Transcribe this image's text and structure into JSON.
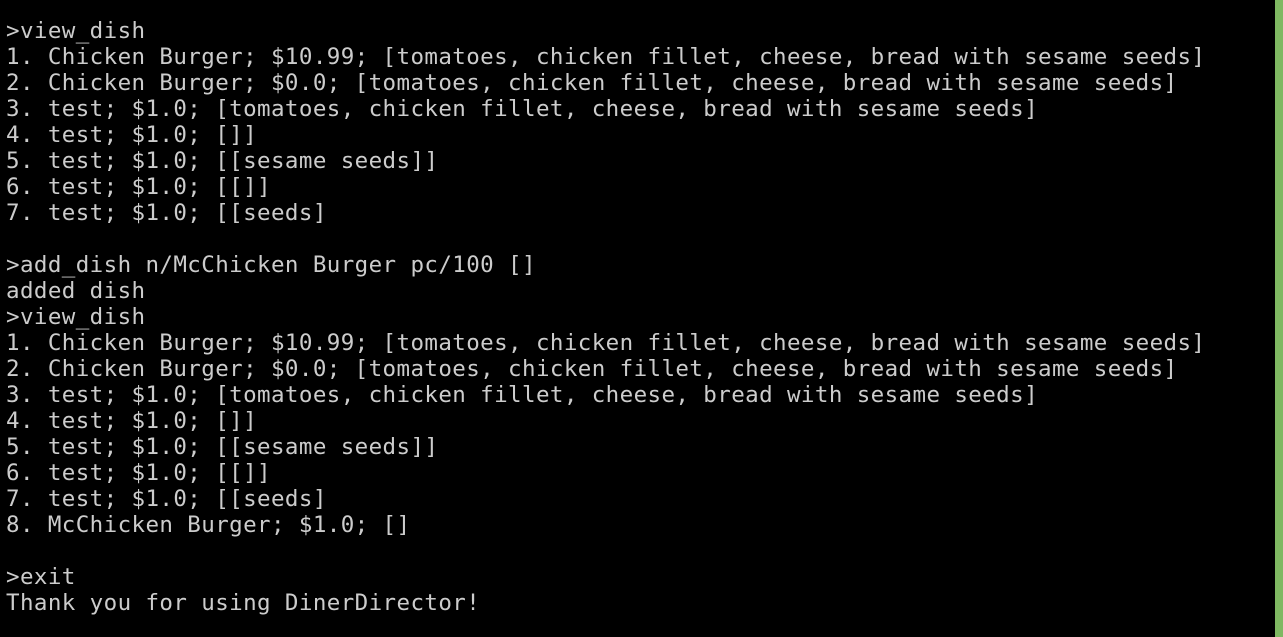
{
  "window": {
    "scrollbar_color": "#7fb862",
    "background_color": "#000000",
    "text_color": "#cccccc"
  },
  "lines": [
    ">view_dish",
    "1. Chicken Burger; $10.99; [tomatoes, chicken fillet, cheese, bread with sesame seeds]",
    "2. Chicken Burger; $0.0; [tomatoes, chicken fillet, cheese, bread with sesame seeds]",
    "3. test; $1.0; [tomatoes, chicken fillet, cheese, bread with sesame seeds]",
    "4. test; $1.0; []]",
    "5. test; $1.0; [[sesame seeds]]",
    "6. test; $1.0; [[]]",
    "7. test; $1.0; [[seeds]",
    "",
    ">add_dish n/McChicken Burger pc/100 []",
    "added dish",
    ">view_dish",
    "1. Chicken Burger; $10.99; [tomatoes, chicken fillet, cheese, bread with sesame seeds]",
    "2. Chicken Burger; $0.0; [tomatoes, chicken fillet, cheese, bread with sesame seeds]",
    "3. test; $1.0; [tomatoes, chicken fillet, cheese, bread with sesame seeds]",
    "4. test; $1.0; []]",
    "5. test; $1.0; [[sesame seeds]]",
    "6. test; $1.0; [[]]",
    "7. test; $1.0; [[seeds]",
    "8. McChicken Burger; $1.0; []",
    "",
    ">exit",
    "Thank you for using DinerDirector!"
  ]
}
